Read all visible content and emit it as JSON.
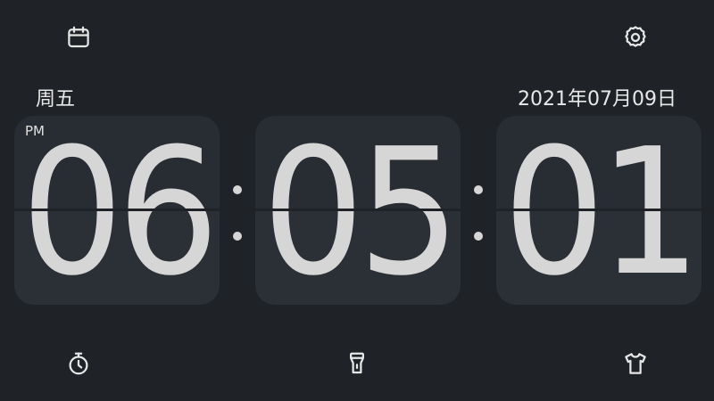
{
  "header": {
    "weekday": "周五",
    "date": "2021年07月09日"
  },
  "clock": {
    "meridiem": "PM",
    "hours": "06",
    "minutes": "05",
    "seconds": "01"
  },
  "icons": {
    "top_left": "calendar-icon",
    "top_right": "gear-icon",
    "bottom_left": "stopwatch-icon",
    "bottom_center": "flashlight-icon",
    "bottom_right": "tshirt-icon"
  },
  "colors": {
    "background": "#1f2327",
    "card": "#2b3036",
    "digit": "#d6d6d6"
  }
}
